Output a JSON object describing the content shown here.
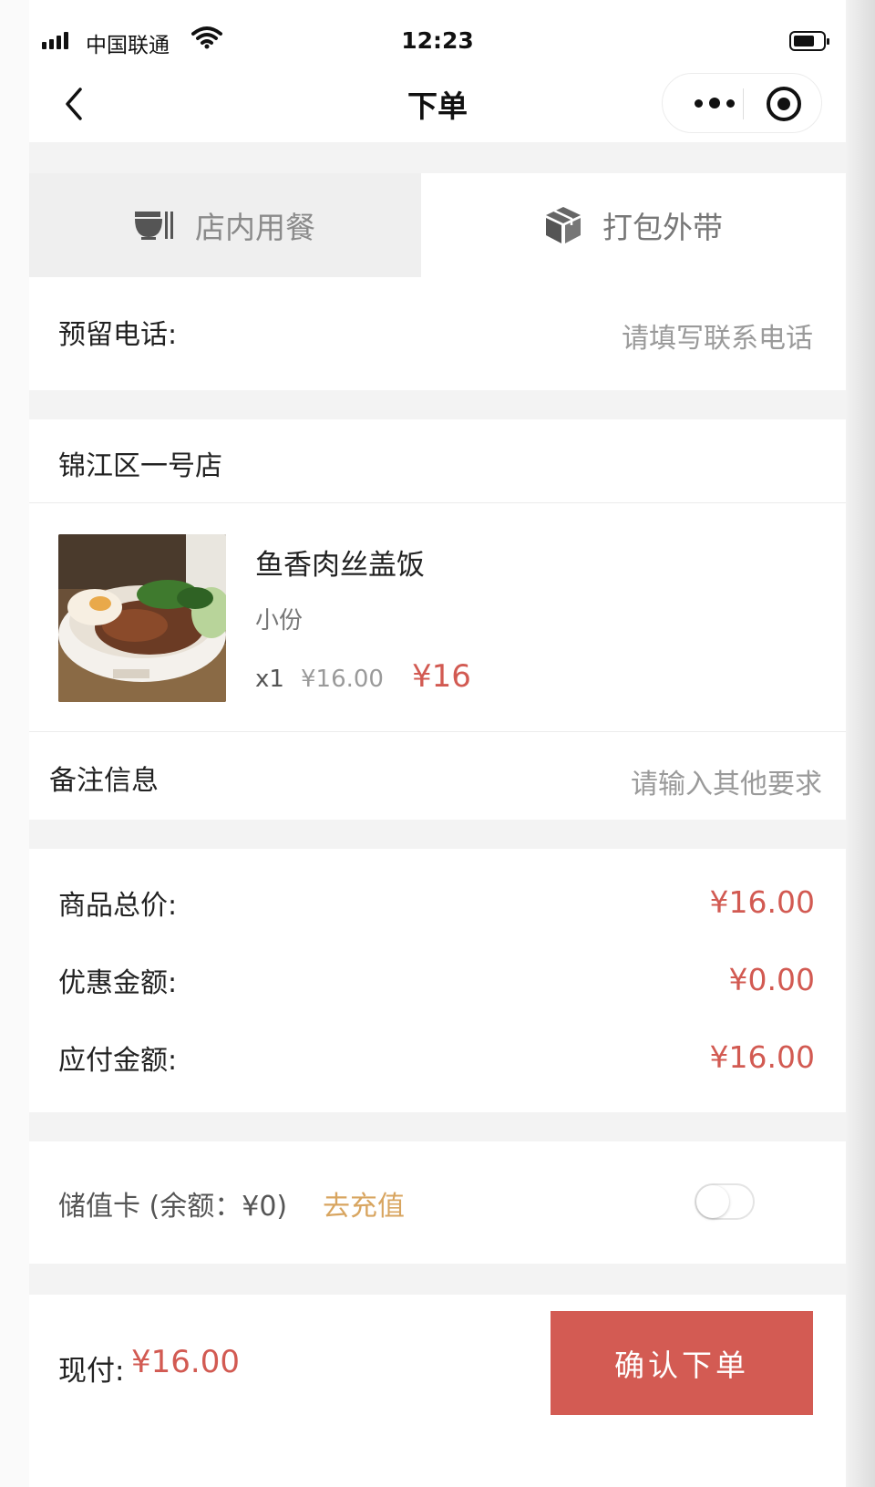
{
  "status_bar": {
    "carrier": "中国联通",
    "time": "12:23",
    "signal_icon": "signal-bars-icon",
    "wifi_icon": "wifi-icon",
    "battery_icon": "battery-icon"
  },
  "nav": {
    "title": "下单",
    "back_icon": "chevron-left-icon",
    "more_icon": "more-dots-icon",
    "close_icon": "target-circle-icon"
  },
  "tabs": [
    {
      "label": "店内用餐",
      "icon": "bowl-icon",
      "selected": true
    },
    {
      "label": "打包外带",
      "icon": "package-box-icon",
      "selected": false
    }
  ],
  "phone": {
    "label": "预留电话:",
    "placeholder": "请填写联系电话"
  },
  "store": {
    "name": "锦江区一号店"
  },
  "order_item": {
    "name": "鱼香肉丝盖饭",
    "spec": "小份",
    "quantity": "x1",
    "unit_price": "¥16.00",
    "total": "¥16"
  },
  "remark": {
    "label": "备注信息",
    "placeholder": "请输入其他要求"
  },
  "summary": [
    {
      "label": "商品总价:",
      "value": "¥16.00"
    },
    {
      "label": "优惠金额:",
      "value": "¥0.00"
    },
    {
      "label": "应付金额:",
      "value": "¥16.00"
    }
  ],
  "stored_card": {
    "label": "储值卡 (余额：¥0)",
    "recharge_label": "去充值",
    "enabled": false
  },
  "footer": {
    "pay_label": "现付:",
    "pay_value": "¥16.00",
    "confirm_label": "确认下单"
  },
  "colors": {
    "accent": "#d35b53",
    "price": "#d25a52",
    "recharge": "#d8a560",
    "section_gap": "#f3f3f3"
  }
}
